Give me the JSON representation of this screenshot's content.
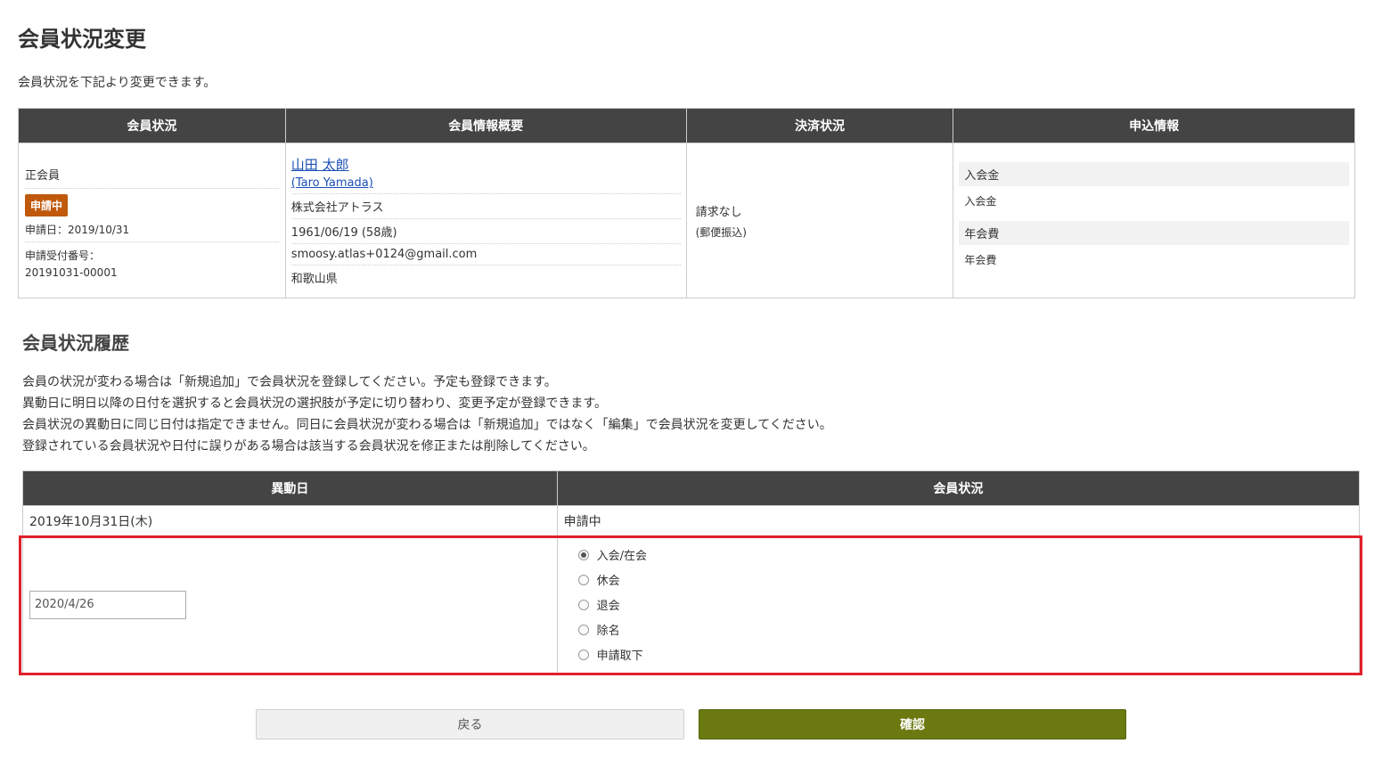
{
  "page": {
    "title": "会員状況変更",
    "description": "会員状況を下記より変更できます。"
  },
  "summary": {
    "headers": [
      "会員状況",
      "会員情報概要",
      "決済状況",
      "申込情報"
    ],
    "status": {
      "type": "正会員",
      "badge": "申請中",
      "apply_date": "申請日：2019/10/31",
      "receipt_label": "申請受付番号：",
      "receipt_number": "20191031-00001"
    },
    "member": {
      "name": "山田 太郎",
      "name_en": "(Taro Yamada)",
      "company": "株式会社アトラス",
      "birth": "1961/06/19 (58歳)",
      "email": "smoosy.atlas+0124@gmail.com",
      "prefecture": "和歌山県"
    },
    "payment": {
      "status": "請求なし",
      "method": "(郵便振込)"
    },
    "application": {
      "items": [
        {
          "head": "入会金",
          "value": "入会金"
        },
        {
          "head": "年会費",
          "value": "年会費"
        }
      ]
    }
  },
  "history": {
    "title": "会員状況履歴",
    "notes": [
      "会員の状況が変わる場合は「新規追加」で会員状況を登録してください。予定も登録できます。",
      "異動日に明日以降の日付を選択すると会員状況の選択肢が予定に切り替わり、変更予定が登録できます。",
      "会員状況の異動日に同じ日付は指定できません。同日に会員状況が変わる場合は「新規追加」ではなく「編集」で会員状況を変更してください。",
      "登録されている会員状況や日付に誤りがある場合は該当する会員状況を修正または削除してください。"
    ],
    "headers": [
      "異動日",
      "会員状況"
    ],
    "rows": [
      {
        "date": "2019年10月31日(木)",
        "status": "申請中"
      }
    ],
    "edit": {
      "date_value": "2020/4/26",
      "options": [
        "入会/在会",
        "休会",
        "退会",
        "除名",
        "申請取下"
      ],
      "selected": 0
    }
  },
  "buttons": {
    "back": "戻る",
    "confirm": "確認"
  },
  "colors": {
    "header_bg": "#444444",
    "badge": "#c0590c",
    "confirm": "#6b7a10",
    "highlight": "#e0202a",
    "link": "#1a4fb5"
  }
}
